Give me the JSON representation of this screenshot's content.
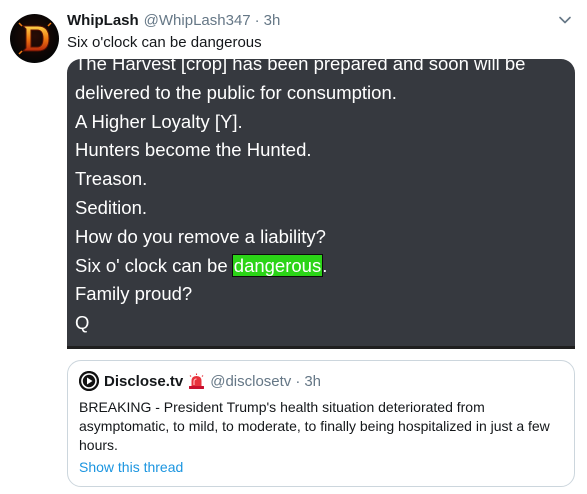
{
  "tweet": {
    "author": {
      "display_name": "WhipLash",
      "handle": "@WhipLash347",
      "avatar_letter": "D"
    },
    "separator": "·",
    "time": "3h",
    "text": "Six o'clock can be dangerous",
    "menu_icon": "chevron-down-icon",
    "image": {
      "lines": [
        "The Harvest [crop] has been prepared and soon will be",
        "delivered to the public for consumption.",
        "A Higher Loyalty [Y].",
        "Hunters become the Hunted.",
        "Treason.",
        "Sedition.",
        "How do you remove a liability?"
      ],
      "highlight_line": {
        "before": "Six o' clock can be ",
        "highlighted": "dangerous",
        "after": "."
      },
      "lines_after": [
        "Family proud?",
        "Q"
      ],
      "background_color": "#36393f",
      "highlight_color": "#2bd417"
    }
  },
  "quoted_tweet": {
    "author": {
      "display_name": "Disclose.tv",
      "handle": "@disclosetv",
      "badge_icon": "siren-emoji-icon"
    },
    "separator": "·",
    "time": "3h",
    "text": "BREAKING - President Trump's health situation deteriorated from asymptomatic, to mild, to moderate, to finally being hospitalized in just a few hours.",
    "show_thread_label": "Show this thread",
    "link_color": "#1b95e0"
  }
}
